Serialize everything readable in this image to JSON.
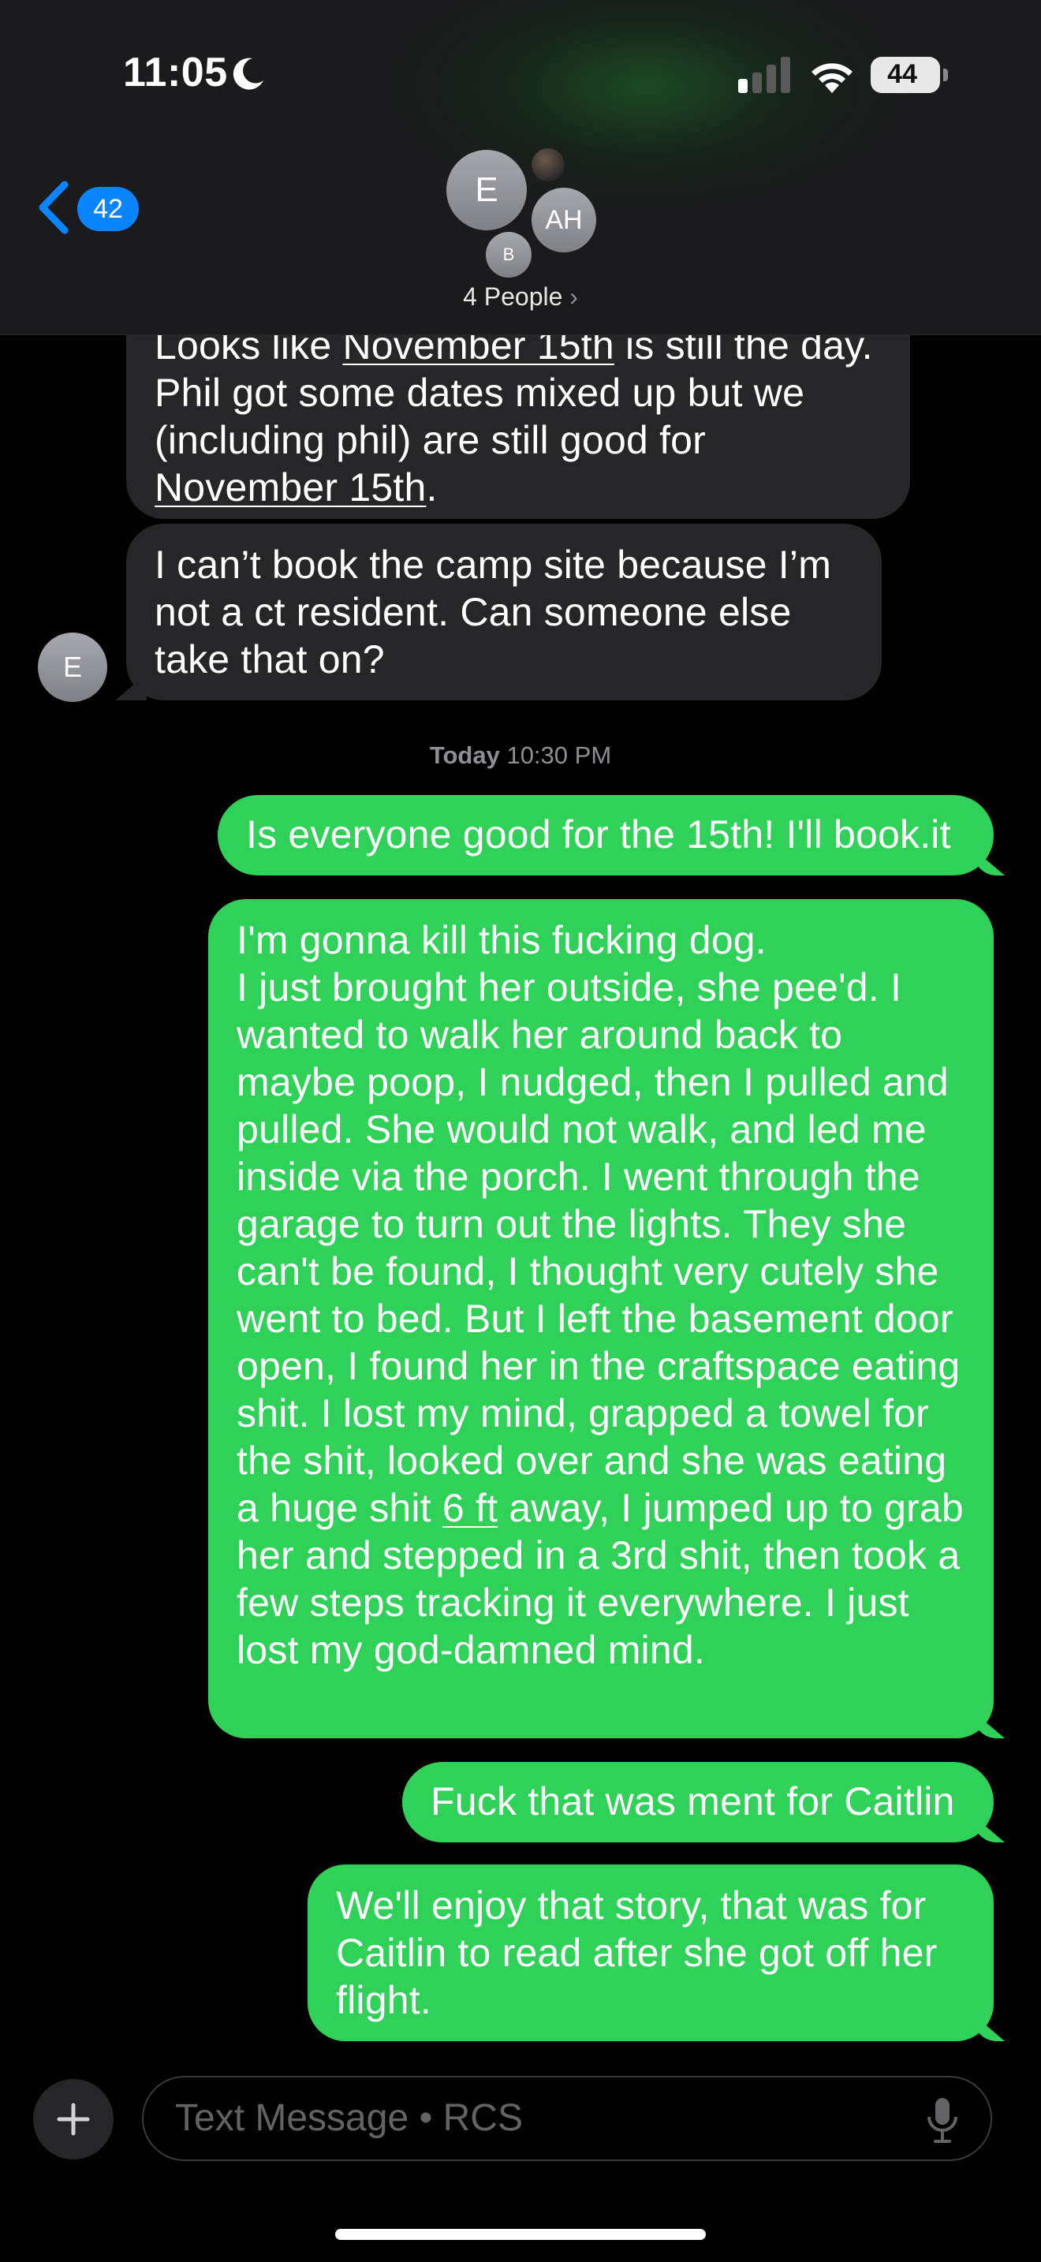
{
  "status_bar": {
    "time": "11:05",
    "battery": "44"
  },
  "header": {
    "back_count": "42",
    "avatars": {
      "main": "E",
      "second": "AH",
      "third": "B"
    },
    "people_label": "4 People",
    "chevron": "›"
  },
  "messages": {
    "m1": {
      "part1": "Looks like ",
      "link1": "November 15th",
      "part2": " is still the day. Phil got some dates mixed up but we (including phil) are still good for ",
      "link2": "November 15th",
      "part3": "."
    },
    "m2": {
      "text": "I can’t book the camp site because I’m not a ct resident. Can someone else take that on?",
      "avatar": "E"
    },
    "timestamp": {
      "day": "Today",
      "time": "10:30 PM"
    },
    "m3": {
      "text": "Is everyone good for the 15th! I'll book.it"
    },
    "m4": {
      "line1": "I'm gonna kill this fucking dog.",
      "part1": "I just brought her outside, she pee'd. I wanted to walk her around back to maybe poop, I nudged, then I pulled and pulled. She would not walk, and led me inside via the porch. I went through the garage to turn out the lights. They she can't be found, I thought very cutely she went to bed. But I left the basement door open, I found her in the craftspace eating shit. I lost my mind, grapped a towel for the shit, looked over and she was eating a huge shit ",
      "link": "6 ft",
      "part2": " away, I jumped up to grab her and stepped in a 3rd shit, then took a few steps tracking it everywhere. I just lost my god-damned mind."
    },
    "m5": {
      "text": "Fuck that was ment for Caitlin"
    },
    "m6": {
      "text": "We'll enjoy that story, that was for Caitlin to read after she got off her flight."
    }
  },
  "composer": {
    "placeholder": "Text Message • RCS"
  },
  "colors": {
    "outgoing": "#30d158",
    "incoming": "#262628",
    "accent": "#0a84ff"
  }
}
